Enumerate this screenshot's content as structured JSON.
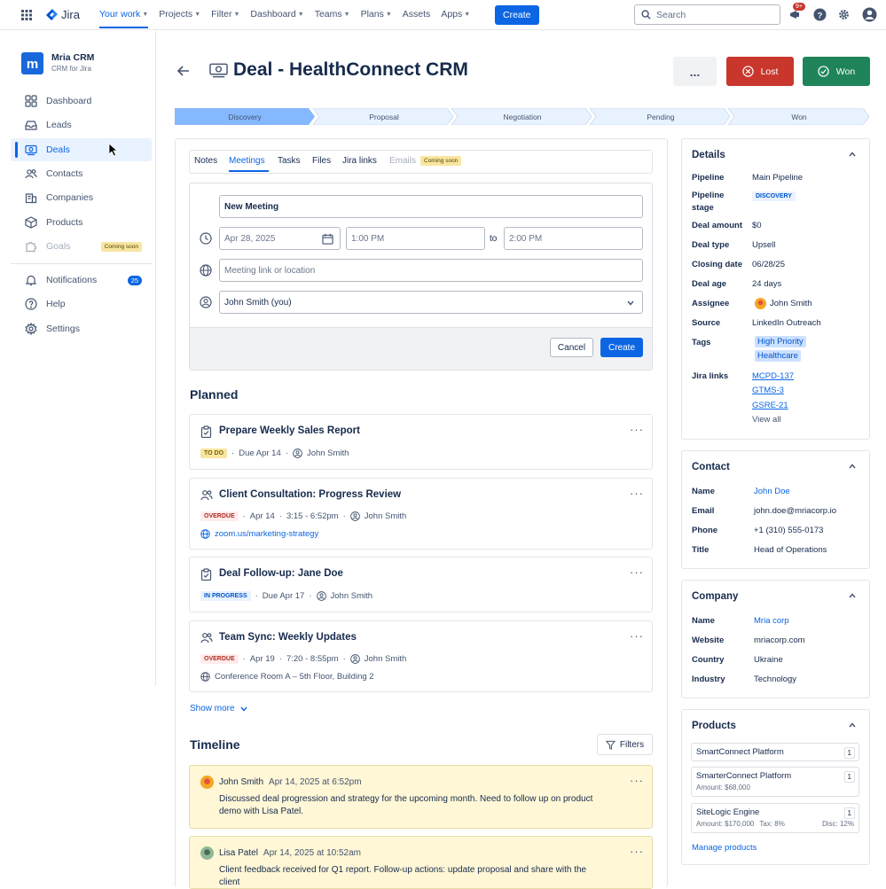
{
  "topnav": {
    "logo_text": "Jira",
    "items": [
      {
        "label": "Your work",
        "chev": true
      },
      {
        "label": "Projects",
        "chev": true
      },
      {
        "label": "Filter",
        "chev": true
      },
      {
        "label": "Dashboard",
        "chev": true
      },
      {
        "label": "Teams",
        "chev": true
      },
      {
        "label": "Plans",
        "chev": true
      },
      {
        "label": "Assets",
        "chev": false
      },
      {
        "label": "Apps",
        "chev": true
      }
    ],
    "create_label": "Create",
    "search_placeholder": "Search",
    "notif_badge": "9+"
  },
  "sidebar": {
    "app_name": "Mria CRM",
    "app_subtitle": "CRM for Jira",
    "items": [
      {
        "label": "Dashboard",
        "icon": "dashboard-icon"
      },
      {
        "label": "Leads",
        "icon": "inbox-icon"
      },
      {
        "label": "Deals",
        "icon": "deal-icon"
      },
      {
        "label": "Contacts",
        "icon": "contacts-icon"
      },
      {
        "label": "Companies",
        "icon": "companies-icon"
      },
      {
        "label": "Products",
        "icon": "box-icon"
      },
      {
        "label": "Goals",
        "icon": "puzzle-icon"
      }
    ],
    "goals_badge": "Coming soon",
    "bottom": [
      {
        "label": "Notifications",
        "icon": "bell-icon"
      },
      {
        "label": "Help",
        "icon": "help-icon"
      },
      {
        "label": "Settings",
        "icon": "gear-icon"
      }
    ],
    "notifications_count": "25"
  },
  "header": {
    "title": "Deal - HealthConnect CRM",
    "more_label": "...",
    "lost_label": "Lost",
    "won_label": "Won"
  },
  "pipeline": [
    "Discovery",
    "Proposal",
    "Negotiation",
    "Pending",
    "Won"
  ],
  "tabs": {
    "items": [
      "Notes",
      "Meetings",
      "Tasks",
      "Files",
      "Jira links",
      "Emails"
    ],
    "emails_badge": "Coming soon"
  },
  "meeting_form": {
    "title_value": "New Meeting",
    "date": "Apr 28, 2025",
    "start_time": "1:00 PM",
    "to": "to",
    "end_time": "2:00 PM",
    "location_placeholder": "Meeting link or location",
    "attendee": "John Smith (you)",
    "cancel_label": "Cancel",
    "create_label": "Create"
  },
  "planned": {
    "heading": "Planned",
    "items": [
      {
        "title": "Prepare Weekly Sales Report",
        "status": "TO DO",
        "date": "Due Apr 14",
        "time": "",
        "assignee": "John Smith",
        "location": ""
      },
      {
        "title": "Client Consultation: Progress Review",
        "status": "OVERDUE",
        "date": "Apr 14",
        "time": "3:15 - 6:52pm",
        "assignee": "John Smith",
        "location": "zoom.us/marketing-strategy"
      },
      {
        "title": "Deal Follow-up: Jane Doe",
        "status": "IN PROGRESS",
        "date": "Due Apr 17",
        "time": "",
        "assignee": "John Smith",
        "location": ""
      },
      {
        "title": "Team Sync: Weekly Updates",
        "status": "OVERDUE",
        "date": "Apr 19",
        "time": "7:20 - 8:55pm",
        "assignee": "John Smith",
        "location": "Conference Room A – 5th Floor, Building 2"
      }
    ],
    "show_more": "Show more"
  },
  "timeline": {
    "heading": "Timeline",
    "filters_label": "Filters",
    "entries": [
      {
        "author": "John Smith",
        "time": "Apr 14, 2025 at 6:52pm",
        "text": "Discussed deal progression and strategy for the upcoming month. Need to follow up on product demo with Lisa Patel."
      },
      {
        "author": "Lisa Patel",
        "time": "Apr 14, 2025 at 10:52am",
        "text": "Client feedback received for Q1 report. Follow-up actions: update proposal and share with the client"
      }
    ]
  },
  "details": {
    "title": "Details",
    "pipeline_label": "Pipeline",
    "pipeline": "Main Pipeline",
    "stage_label_1": "Pipeline",
    "stage_label_2": "stage",
    "stage": "DISCOVERY",
    "amount_label": "Deal amount",
    "amount": "$0",
    "type_label": "Deal type",
    "type": "Upsell",
    "closing_label": "Closing date",
    "closing": "06/28/25",
    "age_label": "Deal age",
    "age": "24 days",
    "assignee_label": "Assignee",
    "assignee": "John Smith",
    "source_label": "Source",
    "source": "LinkedIn Outreach",
    "tags_label": "Tags",
    "tags": [
      "High Priority",
      "Healthcare"
    ],
    "jira_label": "Jira links",
    "jira_links": [
      "MCPD-137",
      "GTMS-3",
      "GSRE-21"
    ],
    "view_all": "View all"
  },
  "contact": {
    "title": "Contact",
    "name_label": "Name",
    "name": "John Doe",
    "email_label": "Email",
    "email": "john.doe@mriacorp.io",
    "phone_label": "Phone",
    "phone": "+1 (310) 555-0173",
    "title_label": "Title",
    "job_title": "Head of Operations"
  },
  "company": {
    "title": "Company",
    "name_label": "Name",
    "name": "Mria corp",
    "website_label": "Website",
    "website": "mriacorp.com",
    "country_label": "Country",
    "country": "Ukraine",
    "industry_label": "Industry",
    "industry": "Technology"
  },
  "products": {
    "title": "Products",
    "items": [
      {
        "name": "SmartConnect Platform",
        "qty": "1",
        "amount": "",
        "tax": "",
        "disc": ""
      },
      {
        "name": "SmarterConnect Platform",
        "qty": "1",
        "amount": "Amount: $68,000",
        "tax": "",
        "disc": ""
      },
      {
        "name": "SiteLogic Engine",
        "qty": "1",
        "amount": "Amount: $170,000",
        "tax": "Tax: 8%",
        "disc": "Disc: 12%"
      }
    ],
    "manage_label": "Manage products"
  },
  "colors": {
    "accent": "#0C66E4",
    "lost": "#C9372C",
    "won": "#1F845A",
    "stage_active": "#85B8FF"
  }
}
